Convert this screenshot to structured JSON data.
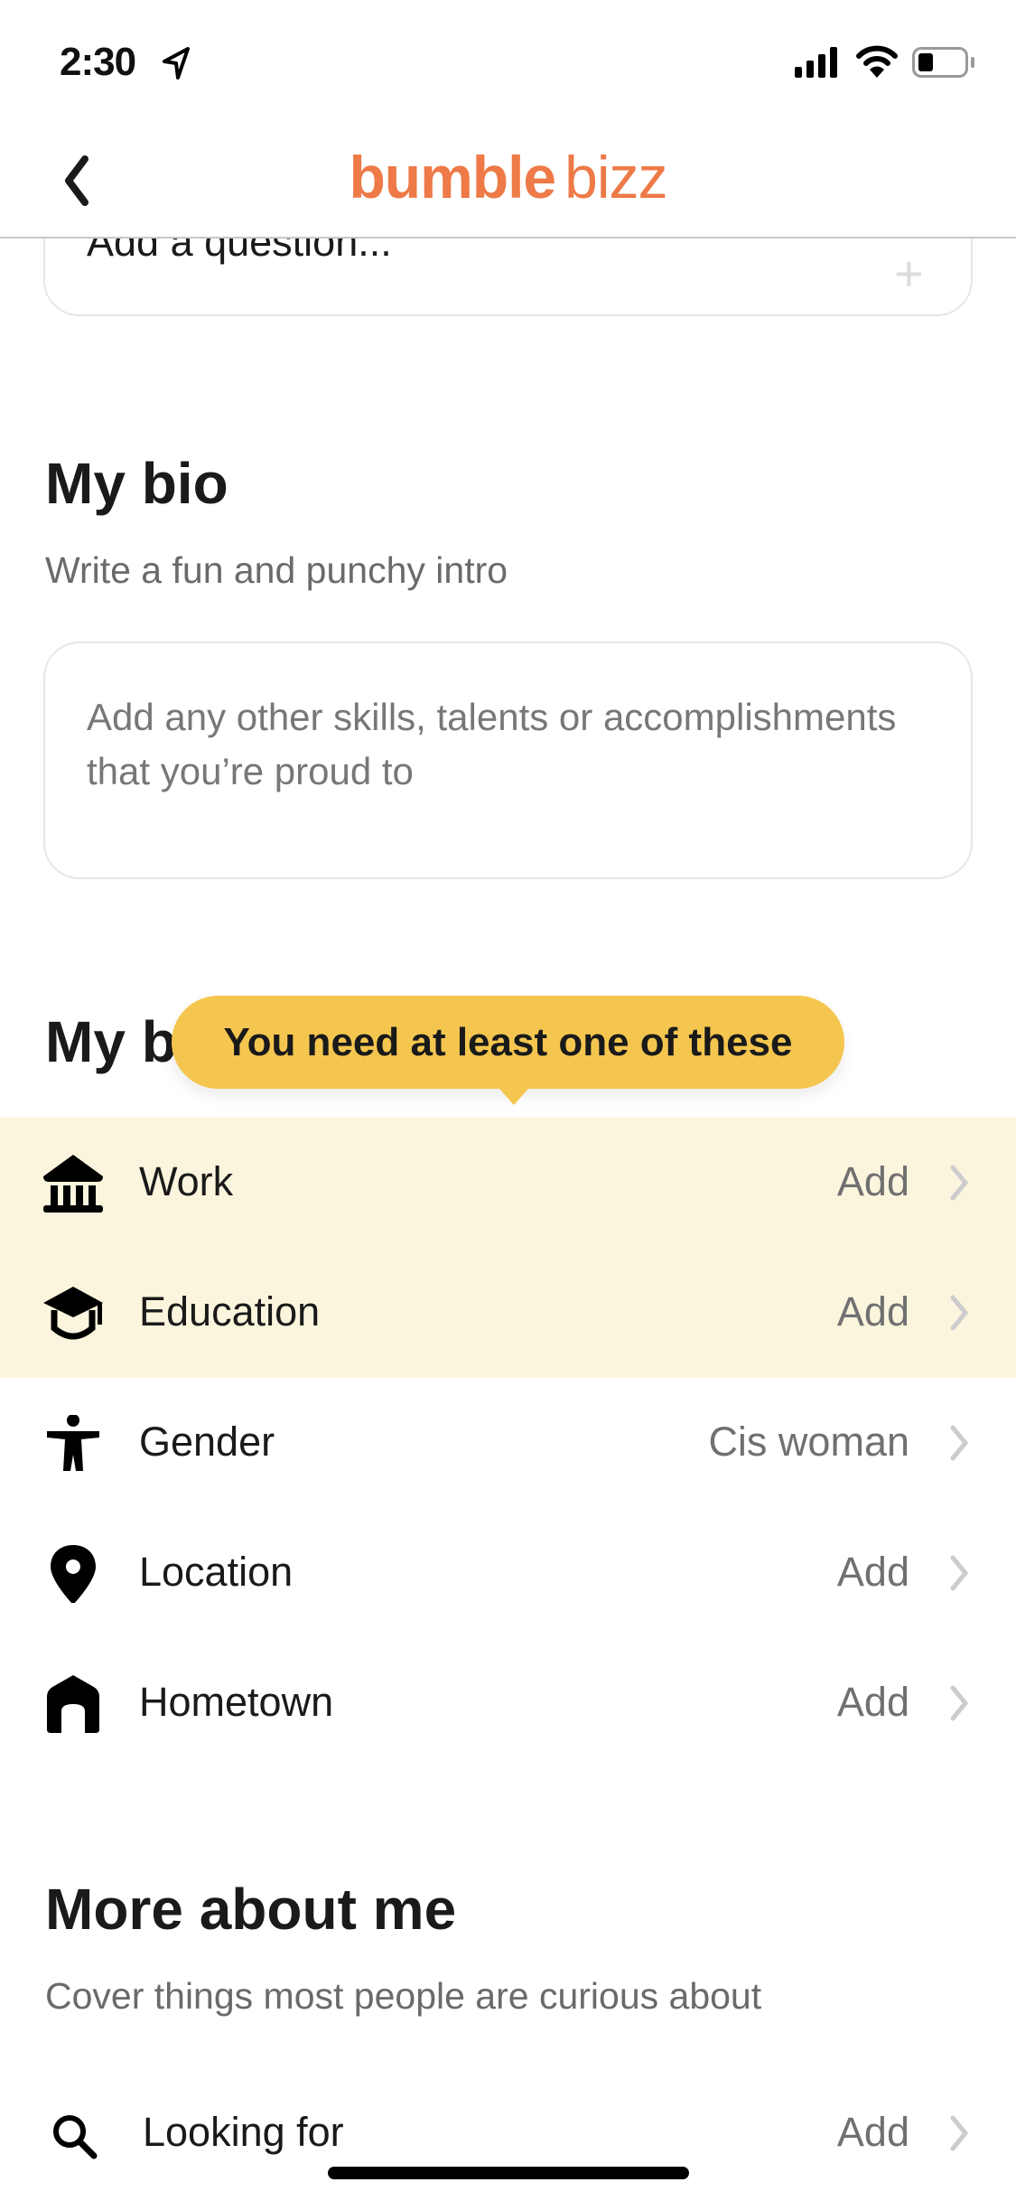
{
  "status_bar": {
    "time": "2:30"
  },
  "header": {
    "logo_part1": "bumble",
    "logo_part2": "bizz",
    "brand_color": "#EE7A47"
  },
  "question_card": {
    "placeholder": "Add a question..."
  },
  "bio": {
    "title": "My bio",
    "subtitle": "Write a fun and punchy intro",
    "placeholder": "Add any other skills, talents or accomplishments that you’re proud to"
  },
  "basics": {
    "title": "My basics",
    "tooltip": "You need at least one of these",
    "tooltip_color": "#F5C64F",
    "highlight_color": "#FCF5DE",
    "items": [
      {
        "label": "Work",
        "value": "Add",
        "icon": "institution-icon"
      },
      {
        "label": "Education",
        "value": "Add",
        "icon": "graduation-cap-icon"
      },
      {
        "label": "Gender",
        "value": "Cis woman",
        "icon": "person-icon"
      },
      {
        "label": "Location",
        "value": "Add",
        "icon": "location-pin-icon"
      },
      {
        "label": "Hometown",
        "value": "Add",
        "icon": "home-icon"
      }
    ]
  },
  "more": {
    "title": "More about me",
    "subtitle": "Cover things most people are curious about",
    "items": [
      {
        "label": "Looking for",
        "value": "Add",
        "icon": "search-icon"
      }
    ]
  }
}
